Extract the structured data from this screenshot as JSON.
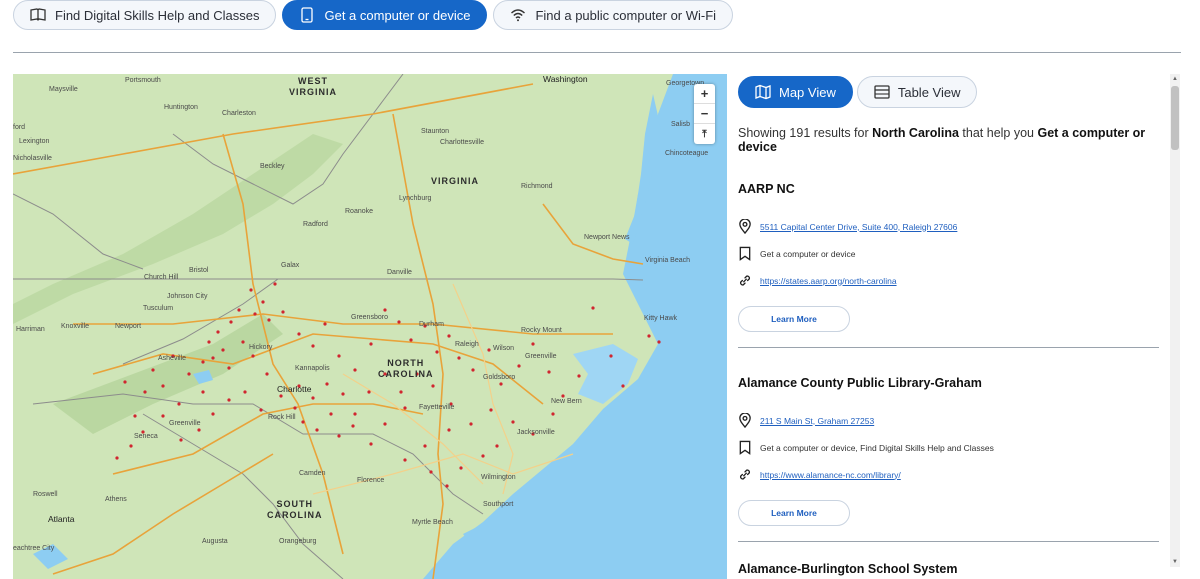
{
  "tabs": [
    {
      "label": "Find Digital Skills Help and Classes",
      "icon": "book-icon",
      "active": false
    },
    {
      "label": "Get a computer or device",
      "icon": "tablet-icon",
      "active": true
    },
    {
      "label": "Find a public computer or Wi-Fi",
      "icon": "wifi-icon",
      "active": false
    }
  ],
  "map": {
    "states": {
      "west_virginia": "WEST\nVIRGINIA",
      "virginia": "VIRGINIA",
      "north_carolina": "NORTH\nCAROLINA",
      "south_carolina": "SOUTH\nCAROLINA"
    },
    "cities": [
      "Washington",
      "Georgetown",
      "Portsmouth",
      "Maysville",
      "Huntington",
      "Charleston",
      "Staunton",
      "Charlottesville",
      "Lexington",
      "Nicholasville",
      "Beckley",
      "Richmond",
      "Salisb",
      "Chincoteague",
      "Lynchburg",
      "Roanoke",
      "Radford",
      "Newport News",
      "Virginia Beach",
      "Galax",
      "Danville",
      "Church Hill",
      "Bristol",
      "Johnson City",
      "Tusculum",
      "Harriman",
      "Knoxville",
      "Newport",
      "Greensboro",
      "Durham",
      "Rocky Mount",
      "Kitty Hawk",
      "Raleigh",
      "Wilson",
      "Asheville",
      "Hickory",
      "Kannapolis",
      "Greenville",
      "Charlotte",
      "Goldsboro",
      "New Bern",
      "Rock Hill",
      "Fayetteville",
      "Jacksonville",
      "Greenville",
      "Seneca",
      "Camden",
      "Florence",
      "Wilmington",
      "Roswell",
      "Athens",
      "Southport",
      "Atlanta",
      "Myrtle Beach",
      "Augusta",
      "Orangeburg",
      "eachtree City",
      "ford"
    ],
    "zoom_in": "+",
    "zoom_out": "−",
    "reset": "⤒"
  },
  "view_toggle": [
    {
      "label": "Map View",
      "icon": "map-icon",
      "active": true
    },
    {
      "label": "Table View",
      "icon": "table-icon",
      "active": false
    }
  ],
  "summary": {
    "prefix": "Showing 191 results for",
    "state": "North Carolina",
    "middle": "that help you",
    "category": "Get a computer or device"
  },
  "results": [
    {
      "name": "AARP NC",
      "address": "5511 Capital Center Drive, Suite 400, Raleigh 27606",
      "services": "Get a computer or device",
      "url": "https://states.aarp.org/north-carolina",
      "learn_more": "Learn More"
    },
    {
      "name": "Alamance County Public Library-Graham",
      "address": "211 S Main St, Graham 27253",
      "services": "Get a computer or device, Find Digital Skills Help and Classes",
      "url": "https://www.alamance-nc.com/library/",
      "learn_more": "Learn More"
    },
    {
      "name": "Alamance-Burlington School System"
    }
  ],
  "colors": {
    "accent": "#1667c8",
    "marker": "#d0252f",
    "water": "#8dcdf2",
    "land": "#cfe5b8"
  }
}
